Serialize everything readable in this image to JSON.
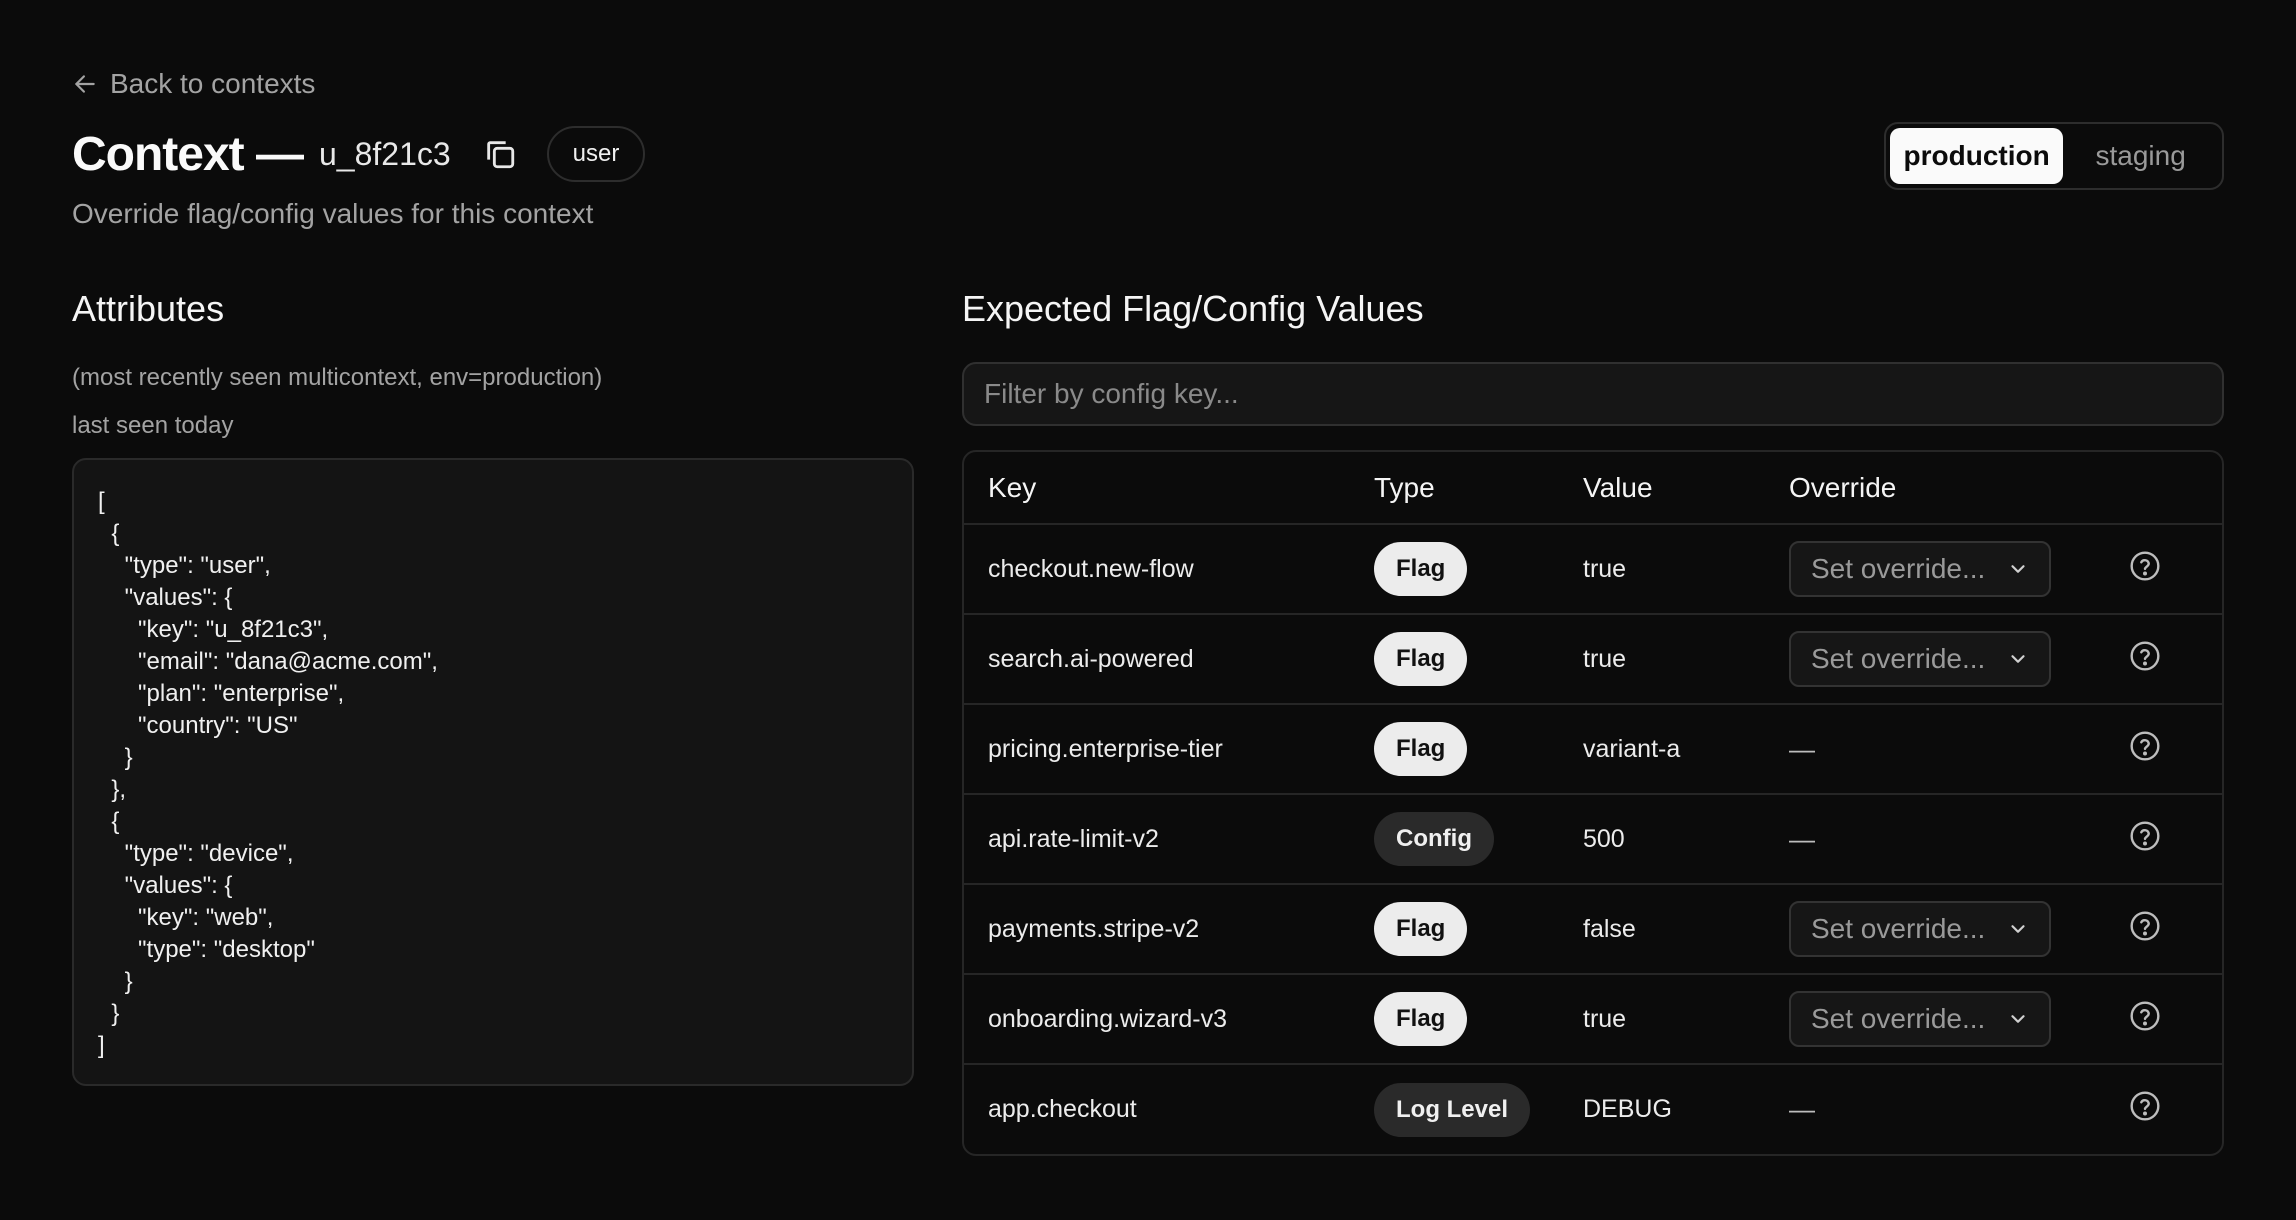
{
  "nav": {
    "back_label": "Back to contexts"
  },
  "header": {
    "title": "Context —",
    "context_key": "u_8f21c3",
    "kind_badge": "user",
    "subtitle": "Override flag/config values for this context"
  },
  "environments": {
    "options": [
      "production",
      "staging"
    ],
    "active": "production"
  },
  "attributes": {
    "title": "Attributes",
    "meta": "(most recently seen multicontext, env=production)",
    "last_seen": "last seen today",
    "json_text": "[\n  {\n    \"type\": \"user\",\n    \"values\": {\n      \"key\": \"u_8f21c3\",\n      \"email\": \"dana@acme.com\",\n      \"plan\": \"enterprise\",\n      \"country\": \"US\"\n    }\n  },\n  {\n    \"type\": \"device\",\n    \"values\": {\n      \"key\": \"web\",\n      \"type\": \"desktop\"\n    }\n  }\n]"
  },
  "values_section": {
    "title": "Expected Flag/Config Values",
    "filter_placeholder": "Filter by config key...",
    "columns": [
      "Key",
      "Type",
      "Value",
      "Override"
    ],
    "override_placeholder": "Set override...",
    "rows": [
      {
        "key": "checkout.new-flow",
        "type": "Flag",
        "type_style": "light",
        "value": "true",
        "override": "select"
      },
      {
        "key": "search.ai-powered",
        "type": "Flag",
        "type_style": "light",
        "value": "true",
        "override": "select"
      },
      {
        "key": "pricing.enterprise-tier",
        "type": "Flag",
        "type_style": "light",
        "value": "variant-a",
        "override": "—"
      },
      {
        "key": "api.rate-limit-v2",
        "type": "Config",
        "type_style": "dark",
        "value": "500",
        "override": "—"
      },
      {
        "key": "payments.stripe-v2",
        "type": "Flag",
        "type_style": "light",
        "value": "false",
        "override": "select"
      },
      {
        "key": "onboarding.wizard-v3",
        "type": "Flag",
        "type_style": "light",
        "value": "true",
        "override": "select"
      },
      {
        "key": "app.checkout",
        "type": "Log Level",
        "type_style": "dark",
        "value": "DEBUG",
        "override": "—"
      }
    ]
  },
  "colors": {
    "background": "#0b0b0b",
    "text": "#f2f2f2",
    "muted": "#a3a3a3",
    "border": "#262626"
  },
  "icons": [
    "arrow-left-icon",
    "copy-icon",
    "chevron-down-icon",
    "help-circle-icon"
  ]
}
